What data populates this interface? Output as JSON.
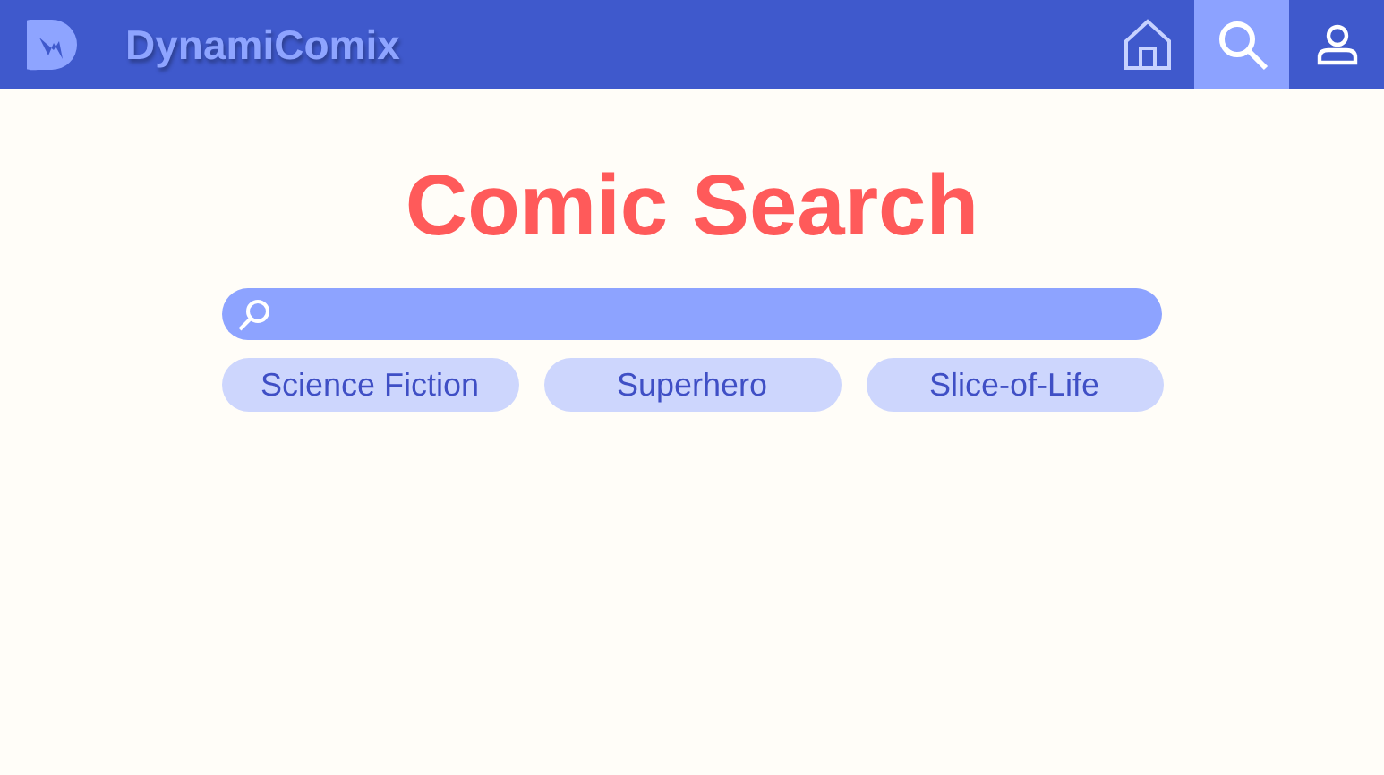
{
  "header": {
    "title": "DynamiComix",
    "nav": [
      {
        "kind": "home",
        "selected": false
      },
      {
        "kind": "search",
        "selected": true
      },
      {
        "kind": "profile",
        "selected": false
      }
    ]
  },
  "heading": "Comic Search",
  "search": {
    "kind": "search-field"
  },
  "tags": [
    {
      "label": "Science Fiction"
    },
    {
      "label": "Superhero"
    },
    {
      "label": "Slice-of-Life"
    }
  ]
}
